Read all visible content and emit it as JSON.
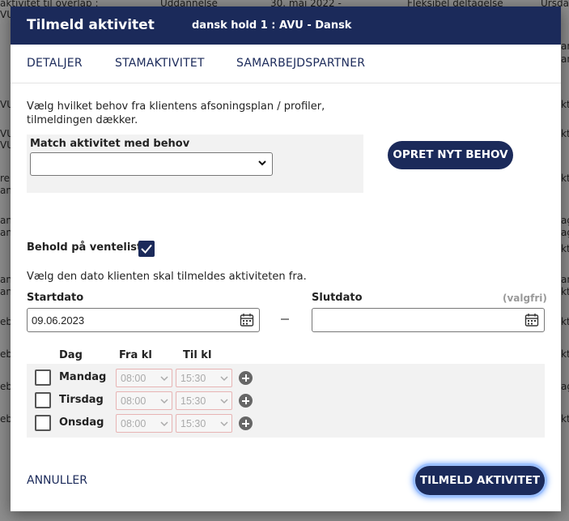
{
  "background": {
    "left_fragments": [
      "aktivitet til overlap :",
      "VU",
      "VU",
      "VU",
      "VU",
      "re",
      "an",
      "an",
      "an",
      "an",
      "an",
      "eb",
      "eb",
      "eb",
      "eb"
    ],
    "top_items": [
      "Uddannelse",
      "30. maj 2022 -",
      "Fleksibel deltagelse",
      "Ursda"
    ],
    "right_fragments": [
      "and",
      "an",
      "kt",
      "kt",
      "kt",
      "ag",
      "ag",
      "kt",
      "and",
      "kt",
      "kt",
      "kt",
      "ag",
      "kt"
    ]
  },
  "modal": {
    "title": "Tilmeld aktivitet",
    "subtitle": "dansk hold 1 : AVU - Dansk"
  },
  "tabs": [
    "DETALJER",
    "STAMAKTIVITET",
    "SAMARBEJDSPARTNER"
  ],
  "needs": {
    "instruction": "Vælg hvilket behov fra klientens afsoningsplan / profiler, tilmeldingen dækker.",
    "match_label": "Match aktivitet med behov",
    "match_value": "",
    "new_need_button": "OPRET NYT BEHOV"
  },
  "waitlist": {
    "label": "Behold på venteliste",
    "checked": true
  },
  "dates": {
    "instruction": "Vælg den dato klienten skal tilmeldes aktiviteten fra.",
    "start_label": "Startdato",
    "start_value": "09.06.2023",
    "end_label": "Slutdato",
    "end_optional": "(valgfri)",
    "end_value": ""
  },
  "schedule": {
    "headers": [
      "Dag",
      "Fra kl",
      "Til kl"
    ],
    "rows": [
      {
        "day": "Mandag",
        "from": "08:00",
        "to": "15:30",
        "checked": false
      },
      {
        "day": "Tirsdag",
        "from": "08:00",
        "to": "15:30",
        "checked": false
      },
      {
        "day": "Onsdag",
        "from": "08:00",
        "to": "15:30",
        "checked": false
      }
    ]
  },
  "footer": {
    "cancel": "ANNULLER",
    "submit": "TILMELD AKTIVITET"
  },
  "colors": {
    "navy": "#1b2a5a",
    "focus_ring": "#9cc0ff"
  }
}
